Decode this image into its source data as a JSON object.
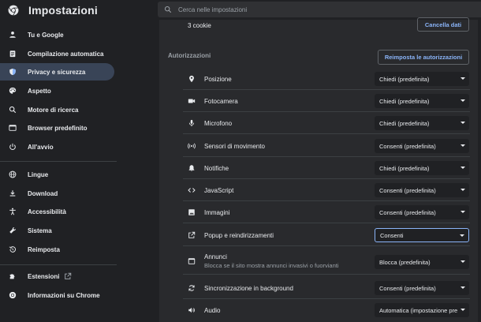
{
  "app": {
    "title": "Impostazioni"
  },
  "search": {
    "placeholder": "Cerca nelle impostazioni"
  },
  "sidebar": {
    "items": [
      {
        "label": "Tu e Google",
        "icon": "person-icon"
      },
      {
        "label": "Compilazione automatica",
        "icon": "clipboard-icon"
      },
      {
        "label": "Privacy e sicurezza",
        "icon": "shield-icon",
        "active": true
      },
      {
        "label": "Aspetto",
        "icon": "palette-icon"
      },
      {
        "label": "Motore di ricerca",
        "icon": "search-icon"
      },
      {
        "label": "Browser predefinito",
        "icon": "browser-icon"
      },
      {
        "label": "All'avvio",
        "icon": "power-icon"
      },
      {
        "label": "Lingue",
        "icon": "globe-icon"
      },
      {
        "label": "Download",
        "icon": "download-icon"
      },
      {
        "label": "Accessibilità",
        "icon": "accessibility-icon"
      },
      {
        "label": "Sistema",
        "icon": "wrench-icon"
      },
      {
        "label": "Reimposta",
        "icon": "history-icon"
      },
      {
        "label": "Estensioni",
        "icon": "puzzle-icon"
      },
      {
        "label": "Informazioni su Chrome",
        "icon": "chrome-icon"
      }
    ]
  },
  "main": {
    "cookie_count": "3 cookie",
    "clear_button": "Cancella dati",
    "section_title": "Autorizzazioni",
    "reset_button": "Reimposta le autorizzazioni",
    "permissions": [
      {
        "label": "Posizione",
        "icon": "location-icon",
        "value": "Chiedi (predefinita)"
      },
      {
        "label": "Fotocamera",
        "icon": "camera-icon",
        "value": "Chiedi (predefinita)"
      },
      {
        "label": "Microfono",
        "icon": "microphone-icon",
        "value": "Chiedi (predefinita)"
      },
      {
        "label": "Sensori di movimento",
        "icon": "sensors-icon",
        "value": "Consenti (predefinita)"
      },
      {
        "label": "Notifiche",
        "icon": "bell-icon",
        "value": "Chiedi (predefinita)"
      },
      {
        "label": "JavaScript",
        "icon": "code-icon",
        "value": "Consenti (predefinita)"
      },
      {
        "label": "Immagini",
        "icon": "image-icon",
        "value": "Consenti (predefinita)"
      },
      {
        "label": "Popup e reindirizzamenti",
        "icon": "open-in-new-icon",
        "value": "Consenti",
        "focused": true
      },
      {
        "label": "Annunci",
        "icon": "ads-icon",
        "value": "Blocca (predefinita)",
        "sub": "Blocca se il sito mostra annunci invasivi o fuorvianti"
      },
      {
        "label": "Sincronizzazione in background",
        "icon": "sync-icon",
        "value": "Consenti (predefinita)"
      },
      {
        "label": "Audio",
        "icon": "speaker-icon",
        "value": "Automatica (impostazione pre"
      }
    ]
  },
  "colors": {
    "background": "#202124",
    "panel": "#292a2d",
    "accent": "#8ab4f8",
    "active_nav": "#394457"
  }
}
